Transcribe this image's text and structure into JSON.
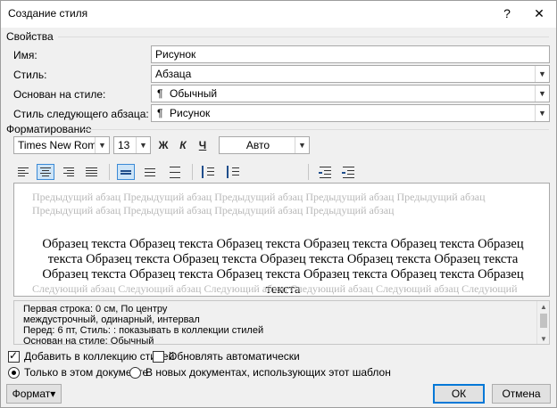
{
  "window": {
    "title": "Создание стиля",
    "help": "?",
    "close": "✕"
  },
  "properties": {
    "section": "Свойства",
    "name_label": "Имя:",
    "name_value": "Рисунок",
    "style_label": "Стиль:",
    "style_value": "Абзаца",
    "based_label": "Основан на стиле:",
    "based_value": "Обычный",
    "next_label": "Стиль следующего абзаца:",
    "next_value": "Рисунок",
    "pilcrow": "¶"
  },
  "formatting": {
    "section": "Форматирование",
    "font": "Times New Roman",
    "size": "13",
    "bold": "Ж",
    "italic": "К",
    "underline": "Ч",
    "color": "Авто"
  },
  "preview": {
    "previous": "Предыдущий абзац Предыдущий абзац Предыдущий абзац Предыдущий абзац Предыдущий абзац Предыдущий абзац Предыдущий абзац Предыдущий абзац Предыдущий абзац",
    "sample": "Образец текста Образец текста Образец текста Образец текста Образец текста Образец текста Образец текста Образец текста Образец текста Образец текста Образец текста Образец текста Образец текста Образец текста Образец текста Образец текста Образец текста",
    "next": "Следующий абзац Следующий абзац Следующий абзац Следующий абзац Следующий абзац Следующий абзац"
  },
  "description": {
    "line1": "Первая строка:  0 см, По центру",
    "line2": "междустрочный,  одинарный, интервал",
    "line3": "Перед:  6 пт, Стиль: : показывать в коллекции стилей",
    "line4": "Основан на стиле: Обычный"
  },
  "options": {
    "add_to_gallery": "Добавить в коллекцию стилей",
    "auto_update": "Обновлять автоматически",
    "this_document": "Только в этом документе",
    "new_documents": "В новых документах, использующих этот шаблон"
  },
  "buttons": {
    "format": "Формат",
    "format_arrow": "▾",
    "ok": "ОК",
    "cancel": "Отмена"
  },
  "icons": {
    "dropdown": "chevron-down-icon"
  },
  "colors": {
    "accent": "#0078d7",
    "selected_tool": "#cde4f7"
  }
}
